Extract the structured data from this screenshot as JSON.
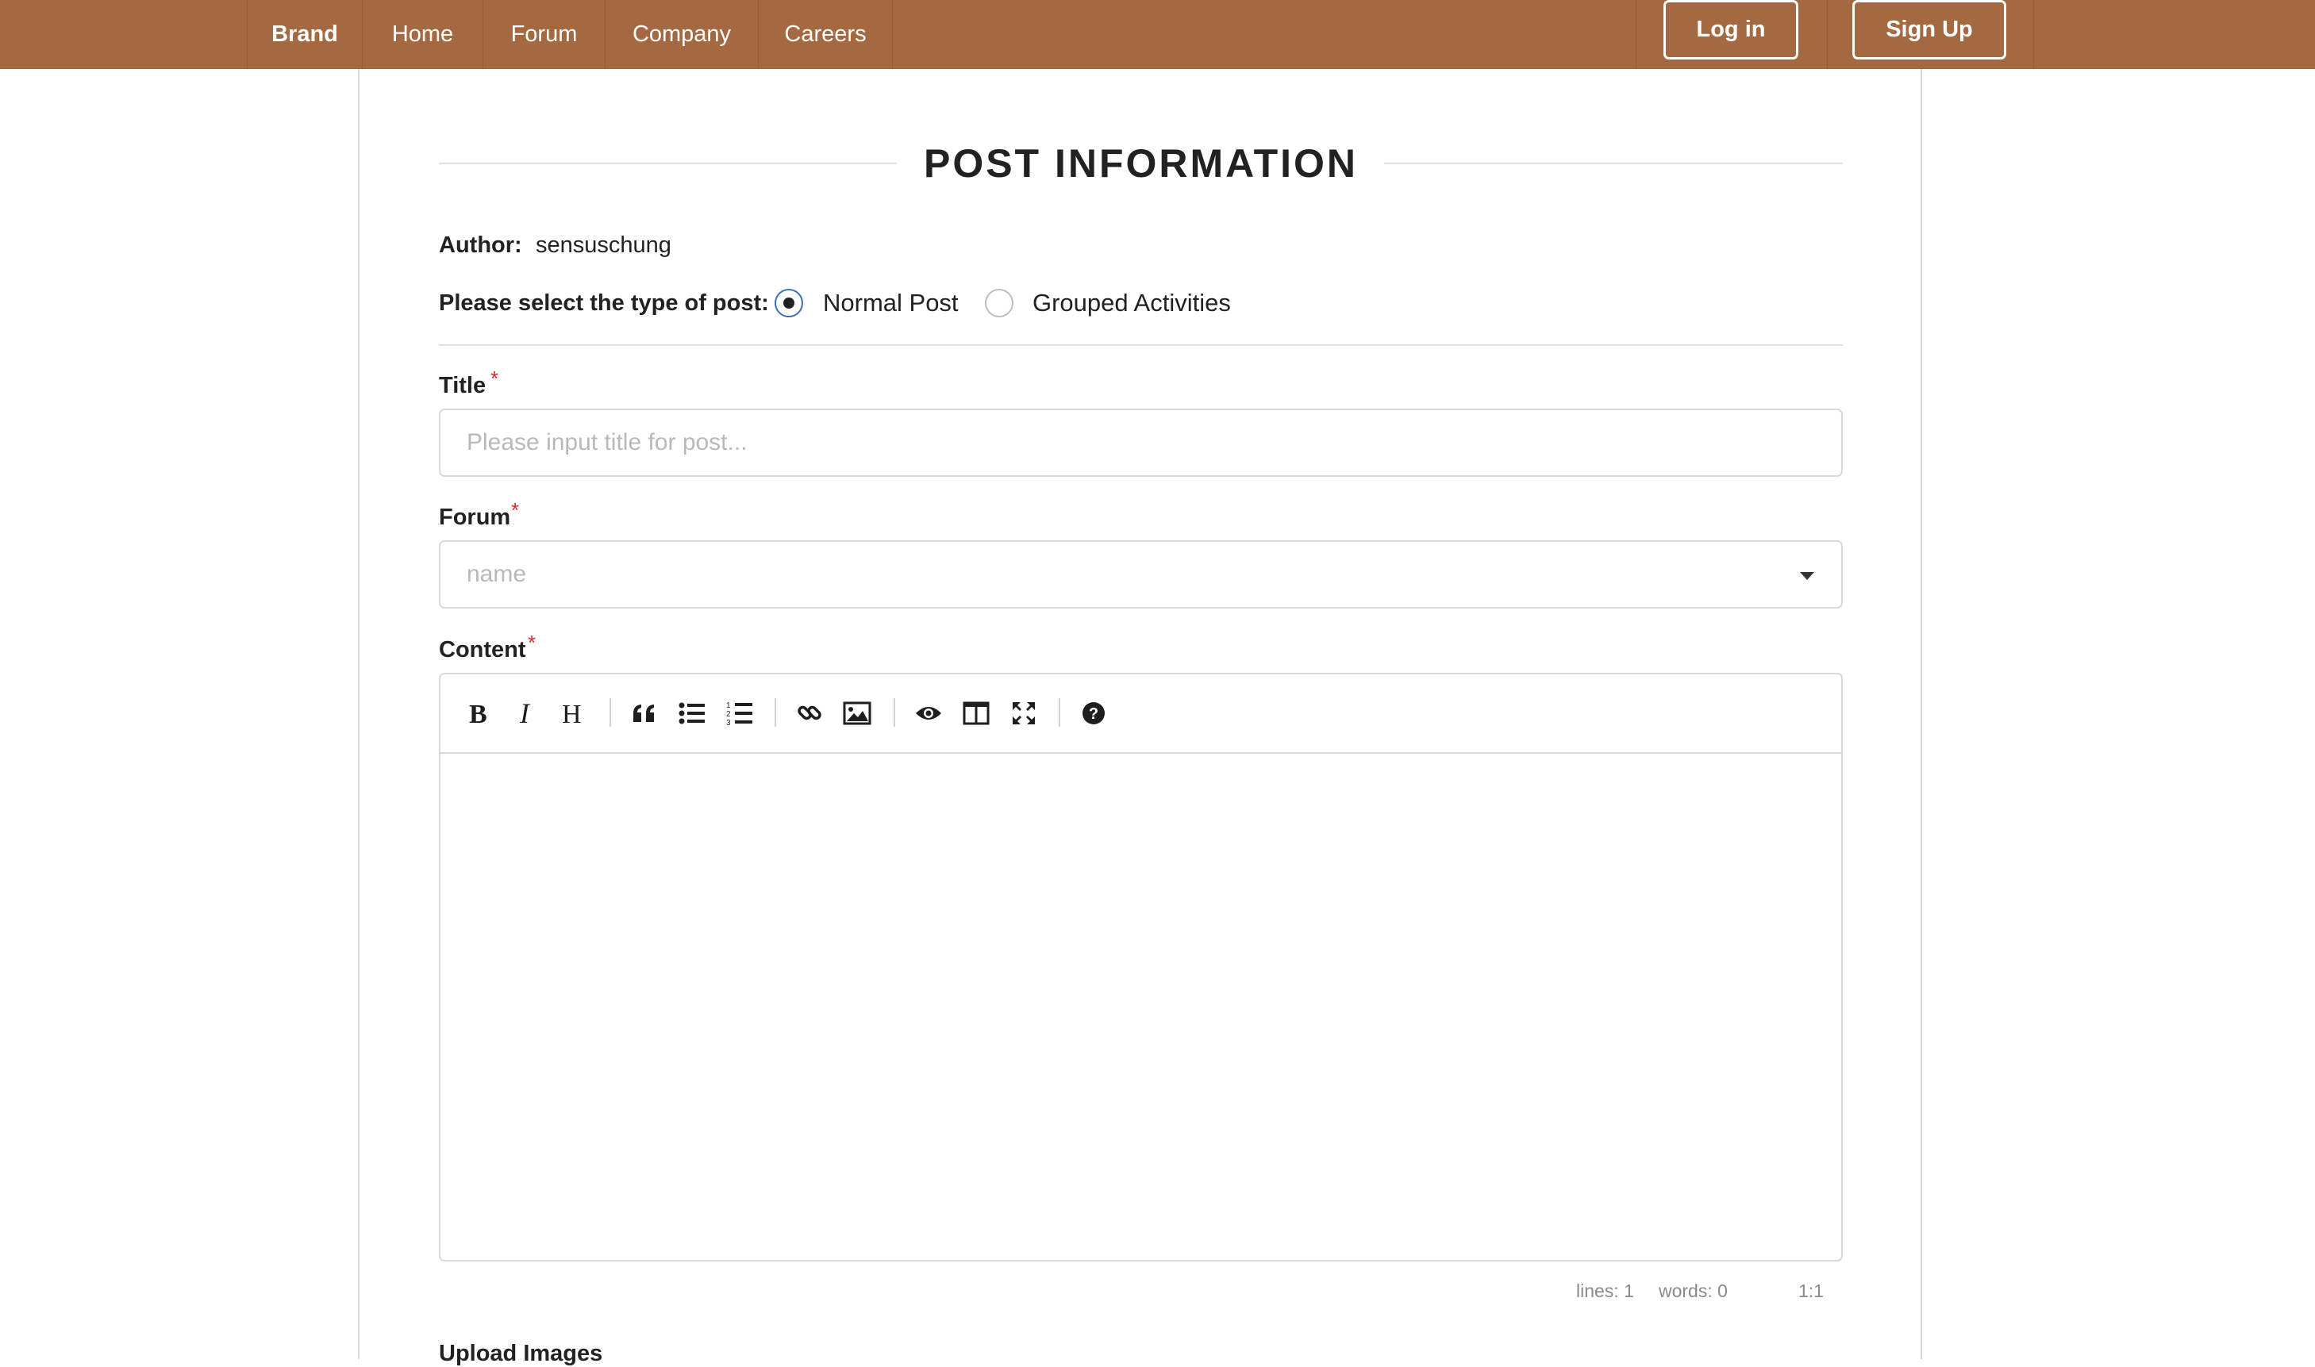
{
  "navbar": {
    "brand": "Brand",
    "items": [
      "Home",
      "Forum",
      "Company",
      "Careers"
    ],
    "login_label": "Log in",
    "signup_label": "Sign Up"
  },
  "page": {
    "heading": "POST INFORMATION",
    "author_label": "Author:",
    "author_value": "sensuschung",
    "post_type_label": "Please select the type of post:",
    "post_type_options": [
      "Normal Post",
      "Grouped Activities"
    ],
    "post_type_selected": "Normal Post",
    "title_label": "Title",
    "title_placeholder": "Please input title for post...",
    "forum_label": "Forum",
    "forum_placeholder": "name",
    "content_label": "Content",
    "required_mark": "*",
    "next_section_label": "Upload Images"
  },
  "editor": {
    "toolbar_icons": [
      "bold-icon",
      "italic-icon",
      "heading-icon",
      "quote-icon",
      "unordered-list-icon",
      "ordered-list-icon",
      "link-icon",
      "image-icon",
      "preview-icon",
      "side-by-side-icon",
      "fullscreen-icon",
      "help-icon"
    ],
    "status": {
      "lines": "lines: 1",
      "words": "words: 0",
      "cursor": "1:1"
    }
  },
  "colors": {
    "navbar_bg": "#a56941",
    "required": "#d62d2d",
    "radio_accent": "#3b6fb6"
  }
}
